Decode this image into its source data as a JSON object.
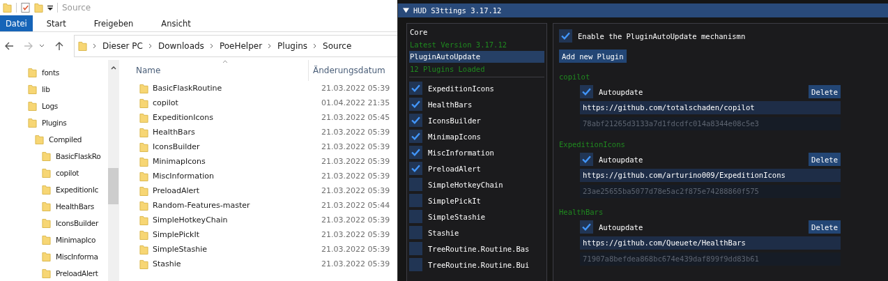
{
  "explorer": {
    "quick_access_title": "Source",
    "ribbon_tabs": [
      {
        "label": "Datei",
        "selected": true
      },
      {
        "label": "Start",
        "selected": false
      },
      {
        "label": "Freigeben",
        "selected": false
      },
      {
        "label": "Ansicht",
        "selected": false
      }
    ],
    "address": [
      "Dieser PC",
      "Downloads",
      "PoeHelper",
      "Plugins",
      "Source"
    ],
    "nav_tree": [
      {
        "label": "fonts"
      },
      {
        "label": "lib"
      },
      {
        "label": "Logs"
      },
      {
        "label": "Plugins",
        "children": [
          {
            "label": "Compiled",
            "children": [
              {
                "label": "BasicFlaskRo"
              },
              {
                "label": "copilot"
              },
              {
                "label": "ExpeditionIc"
              },
              {
                "label": "HealthBars"
              },
              {
                "label": "IconsBuilder"
              },
              {
                "label": "MinimapIco"
              },
              {
                "label": "MiscInforma"
              },
              {
                "label": "PreloadAlert"
              }
            ]
          }
        ]
      }
    ],
    "columns": [
      "Name",
      "Änderungsdatum"
    ],
    "rows": [
      {
        "name": "BasicFlaskRoutine",
        "date": "21.03.2022 05:39"
      },
      {
        "name": "copilot",
        "date": "01.04.2022 21:35"
      },
      {
        "name": "ExpeditionIcons",
        "date": "21.03.2022 05:45"
      },
      {
        "name": "HealthBars",
        "date": "21.03.2022 05:39"
      },
      {
        "name": "IconsBuilder",
        "date": "21.03.2022 05:39"
      },
      {
        "name": "MinimapIcons",
        "date": "21.03.2022 05:39"
      },
      {
        "name": "MiscInformation",
        "date": "21.03.2022 05:39"
      },
      {
        "name": "PreloadAlert",
        "date": "21.03.2022 05:39"
      },
      {
        "name": "Random-Features-master",
        "date": "21.03.2022 05:44"
      },
      {
        "name": "SimpleHotkeyChain",
        "date": "21.03.2022 05:39"
      },
      {
        "name": "SimplePickIt",
        "date": "21.03.2022 05:39"
      },
      {
        "name": "SimpleStashie",
        "date": "21.03.2022 05:39"
      },
      {
        "name": "Stashie",
        "date": "21.03.2022 05:39"
      }
    ]
  },
  "hud": {
    "title": "HUD S3ttings 3.17.12",
    "sections": [
      {
        "name": "Core",
        "status": "Latest Version 3.17.12",
        "selected": false
      },
      {
        "name": "PluginAutoUpdate",
        "status": "12 Plugins Loaded",
        "selected": true
      }
    ],
    "plugins": [
      {
        "name": "ExpeditionIcons",
        "checked": true
      },
      {
        "name": "HealthBars",
        "checked": true
      },
      {
        "name": "IconsBuilder",
        "checked": true
      },
      {
        "name": "MinimapIcons",
        "checked": true
      },
      {
        "name": "MiscInformation",
        "checked": true
      },
      {
        "name": "PreloadAlert",
        "checked": true
      },
      {
        "name": "SimpleHotkeyChain",
        "checked": false
      },
      {
        "name": "SimplePickIt",
        "checked": false
      },
      {
        "name": "SimpleStashie",
        "checked": false
      },
      {
        "name": "Stashie",
        "checked": false
      },
      {
        "name": "TreeRoutine.Routine.Bas",
        "checked": false
      },
      {
        "name": "TreeRoutine.Routine.Bui",
        "checked": false
      }
    ],
    "enable": {
      "label": "Enable the PluginAutoUpdate mechanismn",
      "checked": true
    },
    "add_button": "Add new Plugin",
    "repos": [
      {
        "name": "copilot",
        "autoupdate_label": "Autoupdate",
        "autoupdate": true,
        "delete": "Delete",
        "url": "https://github.com/totalschaden/copilot",
        "hash": "78abf21265d3133a7d1fdcdfc014a8344e08c5e3"
      },
      {
        "name": "ExpeditionIcons",
        "autoupdate_label": "Autoupdate",
        "autoupdate": true,
        "delete": "Delete",
        "url": "https://github.com/arturino009/ExpeditionIcons",
        "hash": "23ae25655ba5077d78e5ac2f875e74288860f575"
      },
      {
        "name": "HealthBars",
        "autoupdate_label": "Autoupdate",
        "autoupdate": true,
        "delete": "Delete",
        "url": "https://github.com/Queuete/HealthBars",
        "hash": "71907a8befdea868bc674e439daf899f9dd83b61"
      }
    ]
  }
}
